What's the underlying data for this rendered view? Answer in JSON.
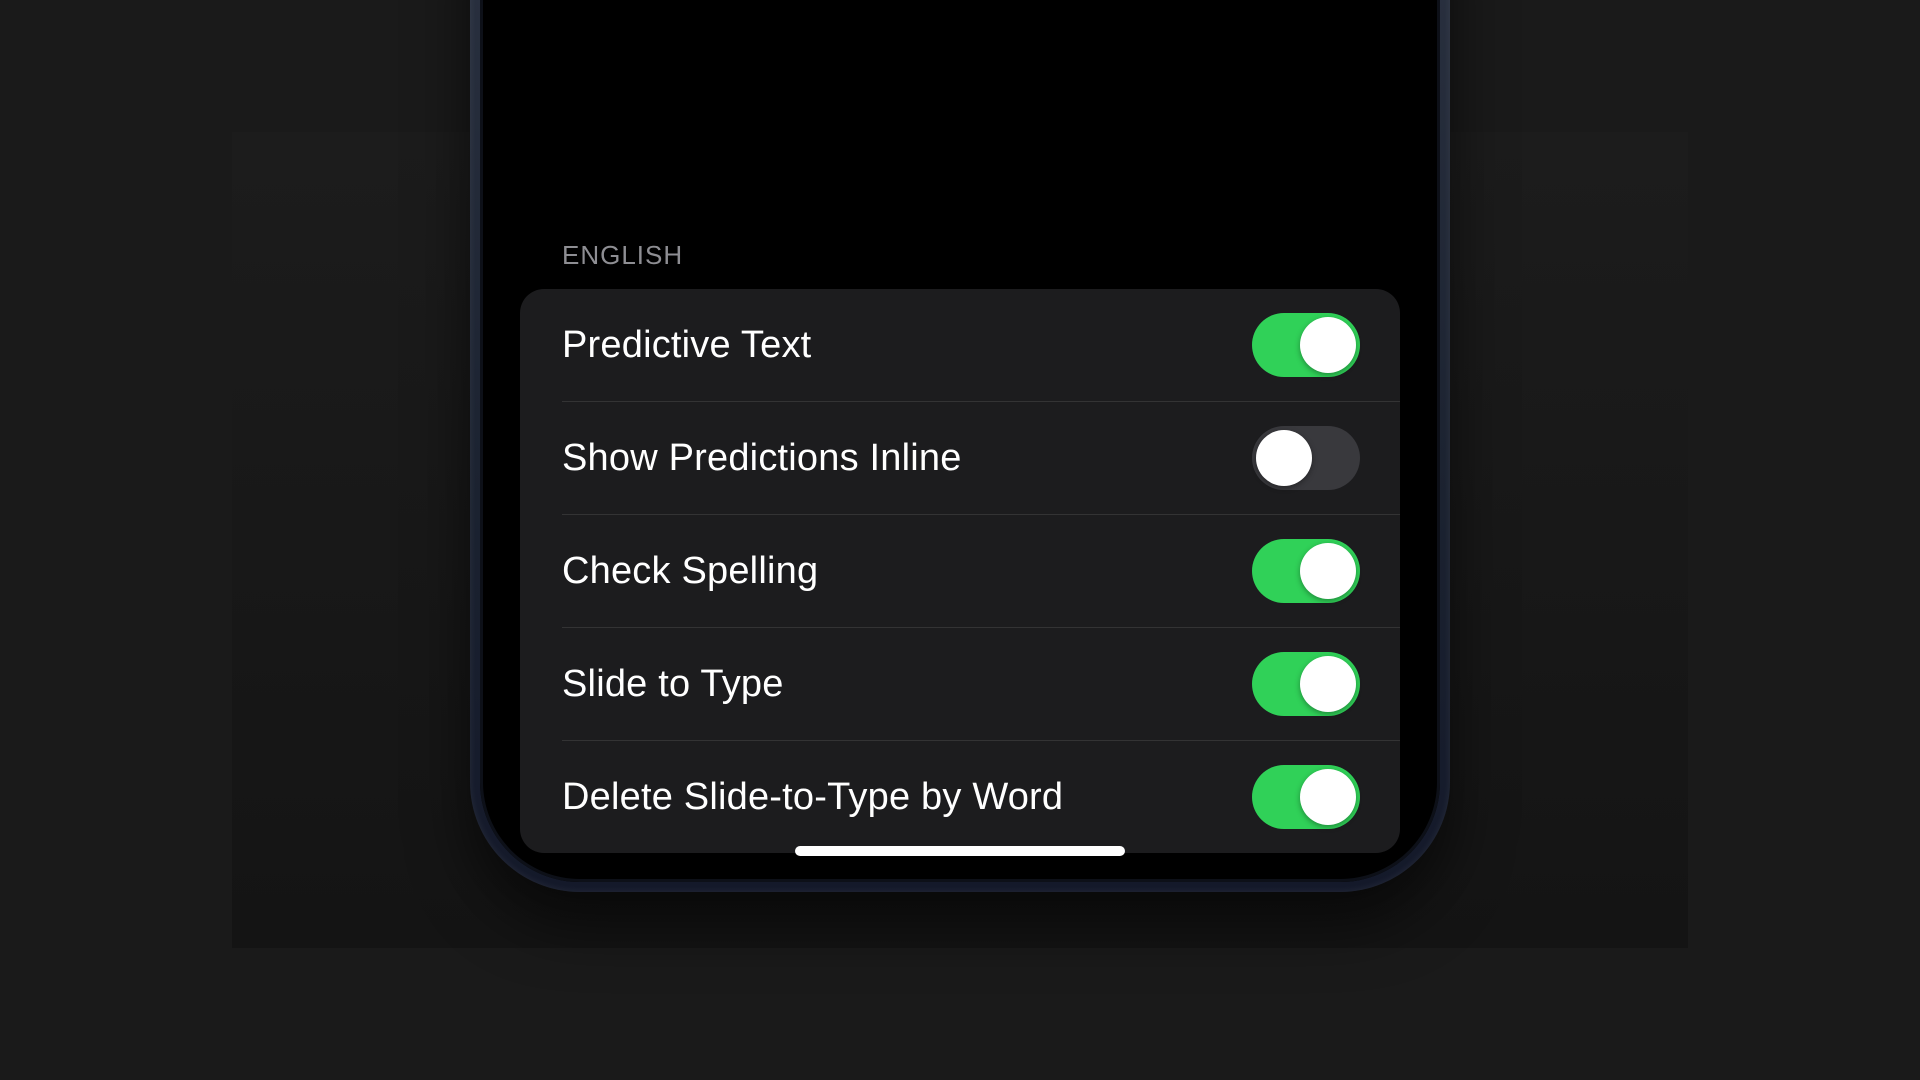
{
  "section": {
    "header": "ENGLISH",
    "items": [
      {
        "id": "predictive-text",
        "label": "Predictive Text",
        "enabled": true
      },
      {
        "id": "show-predictions-inline",
        "label": "Show Predictions Inline",
        "enabled": false
      },
      {
        "id": "check-spelling",
        "label": "Check Spelling",
        "enabled": true
      },
      {
        "id": "slide-to-type",
        "label": "Slide to Type",
        "enabled": true
      },
      {
        "id": "delete-slide-to-type-by-word",
        "label": "Delete Slide-to-Type by Word",
        "enabled": true
      }
    ]
  },
  "colors": {
    "toggle_on": "#30d158",
    "toggle_off": "#39393d",
    "group_bg": "#1c1c1e",
    "header_text": "#8e8e93"
  }
}
